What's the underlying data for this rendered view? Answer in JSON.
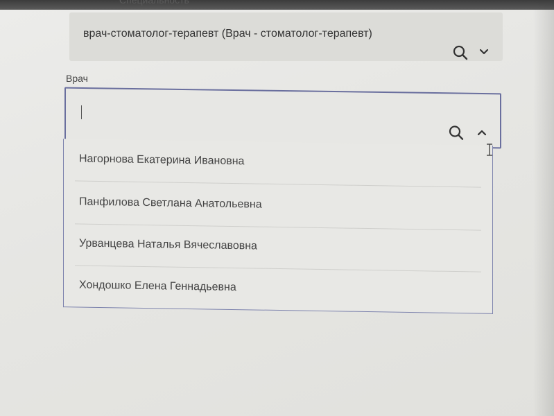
{
  "specialty": {
    "label_fragment": "Специальность",
    "value": "врач-стоматолог-терапевт (Врач - стоматолог-терапевт)"
  },
  "doctor": {
    "label": "Врач",
    "input_value": "",
    "options": [
      "Нагорнова Екатерина Ивановна",
      "Панфилова Светлана Анатольевна",
      "Урванцева Наталья Вячеславовна",
      "Хондошко Елена Геннадьевна"
    ]
  },
  "colors": {
    "focus_border": "#6a6f9e",
    "field_bg": "#dcdcd8"
  },
  "icons": [
    "search-icon",
    "chevron-down-icon",
    "chevron-up-icon",
    "text-cursor-icon"
  ]
}
